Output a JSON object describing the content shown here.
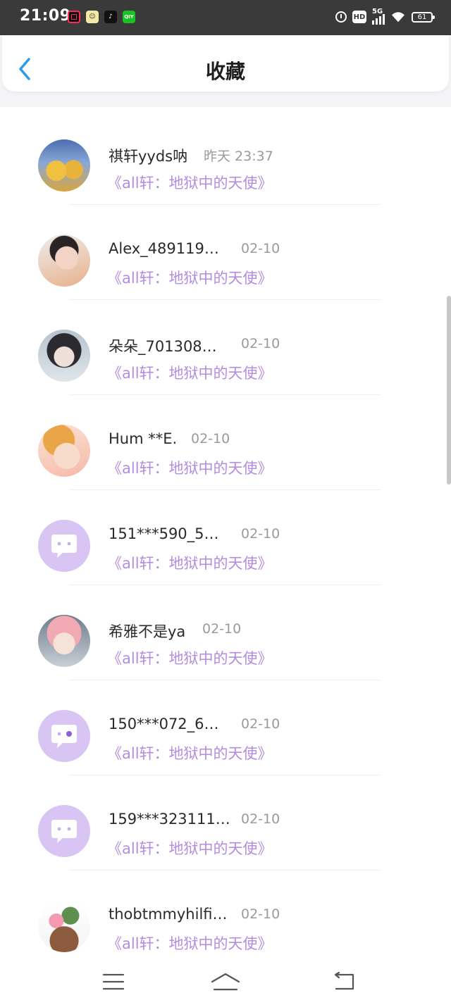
{
  "status_bar": {
    "time": "21:09",
    "network": "5G",
    "hd": "HD",
    "battery": "61"
  },
  "header": {
    "title": "收藏"
  },
  "favorites": [
    {
      "user": "祺轩yyds呐",
      "time": "昨天 23:37",
      "book": "《all轩：地狱中的天使》",
      "avatar": "photo"
    },
    {
      "user": "Alex_489119…",
      "time": "02-10",
      "book": "《all轩：地狱中的天使》",
      "avatar": "photo"
    },
    {
      "user": "朵朵_701308…",
      "time": "02-10",
      "book": "《all轩：地狱中的天使》",
      "avatar": "photo"
    },
    {
      "user": "Hum **E.",
      "time": "02-10",
      "book": "《all轩：地狱中的天使》",
      "avatar": "photo"
    },
    {
      "user": "151***590_5…",
      "time": "02-10",
      "book": "《all轩：地狱中的天使》",
      "avatar": "default"
    },
    {
      "user": "希雅不是ya",
      "time": "02-10",
      "book": "《all轩：地狱中的天使》",
      "avatar": "photo"
    },
    {
      "user": "150***072_6…",
      "time": "02-10",
      "book": "《all轩：地狱中的天使》",
      "avatar": "default"
    },
    {
      "user": "159***323111…",
      "time": "02-10",
      "book": "《all轩：地狱中的天使》",
      "avatar": "default"
    },
    {
      "user": "thobtmmyhilfi…",
      "time": "02-10",
      "book": "《all轩：地狱中的天使》",
      "avatar": "photo"
    }
  ],
  "colors": {
    "accent": "#2a9be8",
    "book_title": "#b48ce0",
    "default_avatar": "#d8c5f3"
  },
  "icons": {
    "back": "chevron-left-icon",
    "nav_menu": "menu-icon",
    "nav_home": "home-icon",
    "nav_back": "return-icon"
  }
}
